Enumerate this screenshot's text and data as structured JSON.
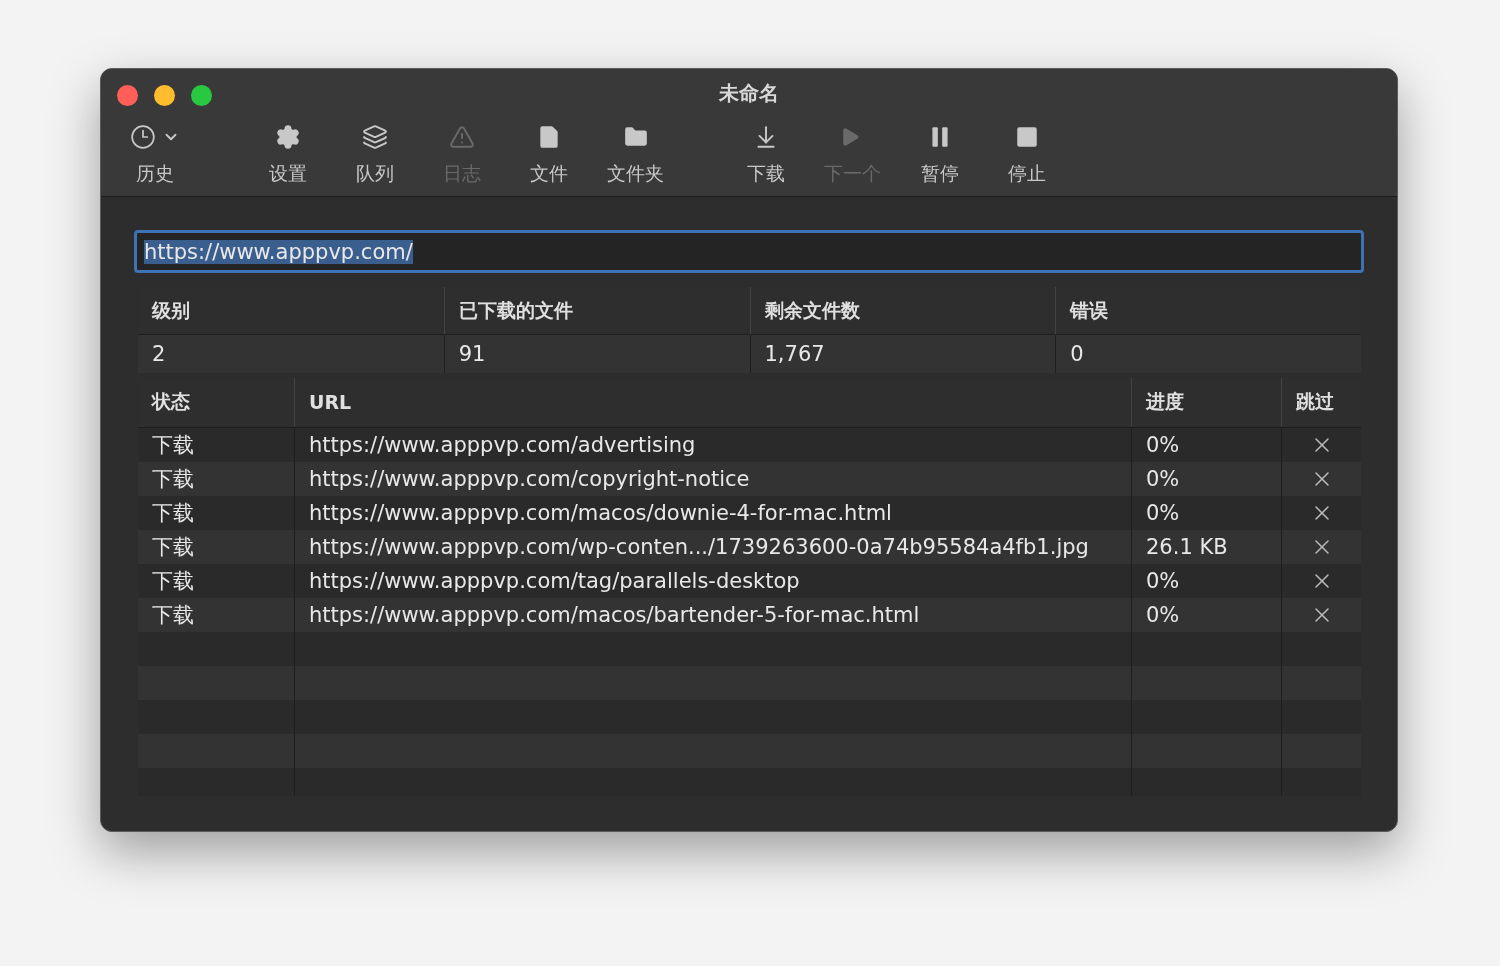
{
  "window": {
    "title": "未命名"
  },
  "toolbar": {
    "history": {
      "label": "历史"
    },
    "groups": [
      [
        {
          "label": "设置",
          "disabled": false
        },
        {
          "label": "队列",
          "disabled": false
        },
        {
          "label": "日志",
          "disabled": true
        },
        {
          "label": "文件",
          "disabled": false
        },
        {
          "label": "文件夹",
          "disabled": false
        }
      ],
      [
        {
          "label": "下载",
          "disabled": false
        },
        {
          "label": "下一个",
          "disabled": true
        },
        {
          "label": "暂停",
          "disabled": false
        },
        {
          "label": "停止",
          "disabled": false
        }
      ]
    ]
  },
  "url_field": {
    "value": "https://www.apppvp.com/",
    "selected": true
  },
  "stats": {
    "columns": [
      "级别",
      "已下载的文件",
      "剩余文件数",
      "错误"
    ],
    "values": [
      "2",
      "91",
      "1,767",
      "0"
    ]
  },
  "downloads": {
    "columns": [
      "状态",
      "URL",
      "进度",
      "跳过"
    ],
    "rows": [
      {
        "status": "下载",
        "url": "https://www.apppvp.com/advertising",
        "progress": "0%"
      },
      {
        "status": "下载",
        "url": "https://www.apppvp.com/copyright-notice",
        "progress": "0%"
      },
      {
        "status": "下载",
        "url": "https://www.apppvp.com/macos/downie-4-for-mac.html",
        "progress": "0%"
      },
      {
        "status": "下载",
        "url": "https://www.apppvp.com/wp-conten.../1739263600-0a74b95584a4fb1.jpg",
        "progress": "26.1 KB"
      },
      {
        "status": "下载",
        "url": "https://www.apppvp.com/tag/parallels-desktop",
        "progress": "0%"
      },
      {
        "status": "下载",
        "url": "https://www.apppvp.com/macos/bartender-5-for-mac.html",
        "progress": "0%"
      }
    ]
  }
}
